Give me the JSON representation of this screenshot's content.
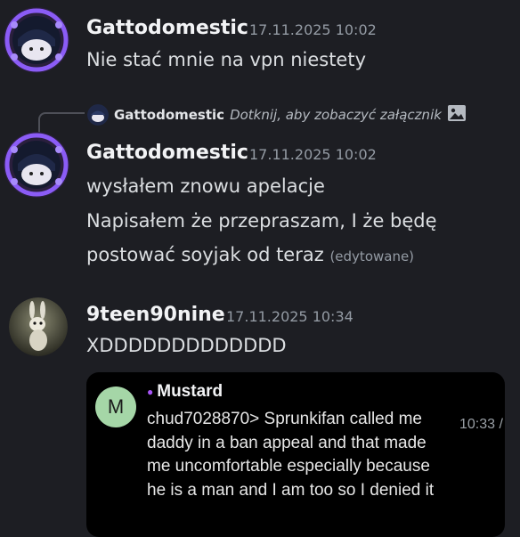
{
  "messages": [
    {
      "author": "Gattodomestic",
      "timestamp": "17.11.2025 10:02",
      "lines": [
        "Nie stać mnie na vpn niestety"
      ]
    },
    {
      "reply": {
        "author": "Gattodomestic",
        "preview": "Dotknij, aby zobaczyć załącznik",
        "icon": "image-icon"
      },
      "author": "Gattodomestic",
      "timestamp": "17.11.2025 10:02",
      "lines": [
        "wysłałem znowu apelacje",
        "Napisałem że przepraszam, I że będę",
        "postować soyjak od teraz"
      ],
      "edited": "(edytowane)"
    },
    {
      "author": "9teen90nine",
      "timestamp": "17.11.2025 10:34",
      "lines": [
        "XDDDDDDDDDDDDD"
      ],
      "embed": {
        "avatar_letter": "M",
        "author": "Mustard",
        "text": "chud7028870> Sprunkifan called me daddy in a ban appeal and that made me uncomfortable especially because he is a man and I am too so I denied it",
        "time": "10:33 /"
      }
    }
  ],
  "colors": {
    "background": "#1d1e23",
    "avatar_frame": "#8b5cf6",
    "embed_bg": "#000000",
    "embed_avatar": "#a5d6a7",
    "role_dot": "#a855f7"
  }
}
